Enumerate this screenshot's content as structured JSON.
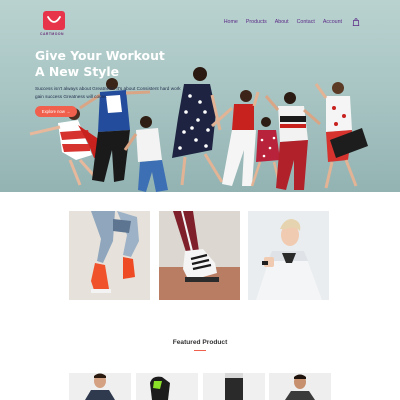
{
  "brand": {
    "name": "CARTMOON"
  },
  "nav": {
    "items": [
      "Home",
      "Products",
      "About",
      "Contact",
      "Account"
    ]
  },
  "hero": {
    "title_line1": "Give Your Workout",
    "title_line2": "A New Style",
    "subtitle": "Success isn't always about Greatness. It's about Consistent hard work gain success Greatness will come.",
    "button": "Explore now →"
  },
  "featured": {
    "title": "Featured Product"
  },
  "colors": {
    "accent": "#f0604d",
    "brand": "#e8344a",
    "nav": "#5c2a86"
  }
}
